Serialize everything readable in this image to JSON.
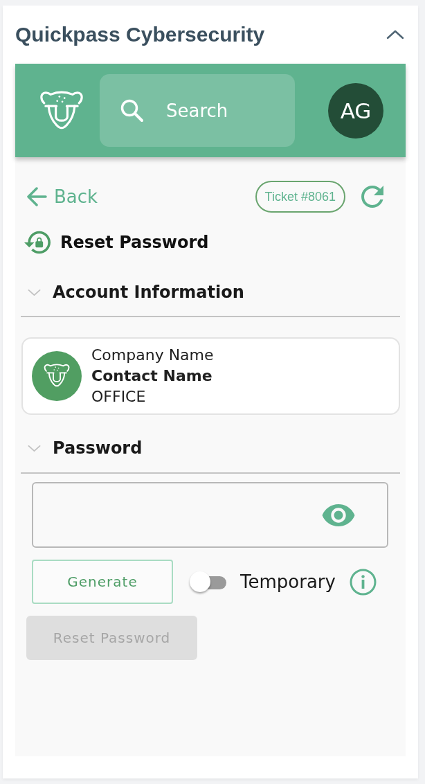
{
  "panel": {
    "title": "Quickpass Cybersecurity",
    "expanded": true
  },
  "header": {
    "search": {
      "placeholder": "Search"
    },
    "avatar": {
      "initials": "AG"
    }
  },
  "toolbar": {
    "back": "Back",
    "ticket": "Ticket #8061"
  },
  "page_title": "Reset Password",
  "account_section": {
    "title": "Account Information",
    "expanded": true,
    "account": {
      "company": "Company Name",
      "contact": "Contact Name",
      "type": "OFFICE"
    }
  },
  "password_section": {
    "title": "Password",
    "expanded": true,
    "generate_button": "Generate",
    "temporary": {
      "label": "Temporary",
      "on": false
    },
    "submit": {
      "label": "Reset Password",
      "disabled": true
    }
  }
}
